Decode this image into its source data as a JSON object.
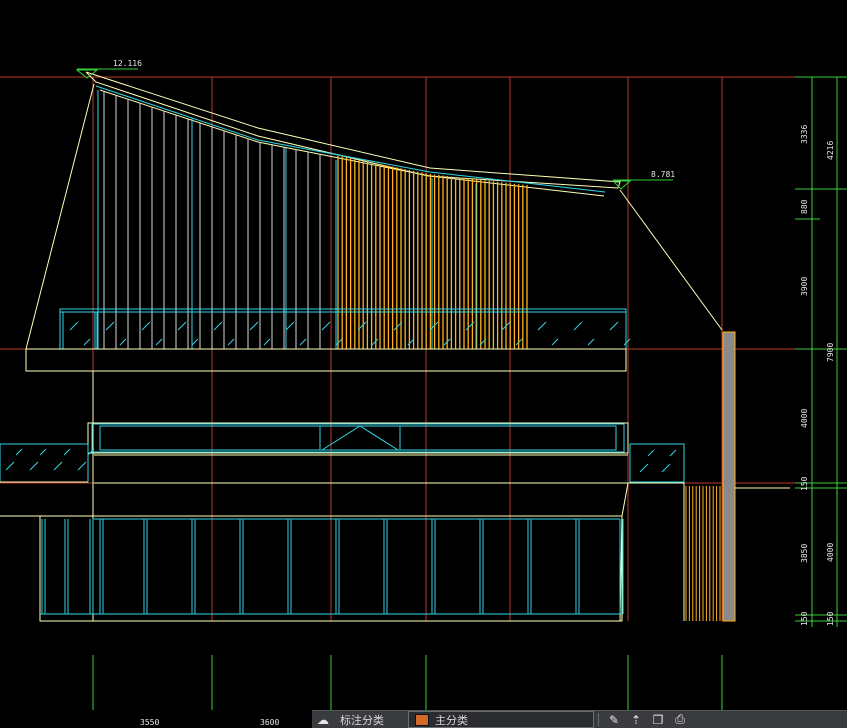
{
  "drawing": {
    "elevation_top": "12.116",
    "elevation_right": "8.781",
    "dims_right_inner": [
      "3336",
      "880",
      "3900",
      "4000",
      "150",
      "3850",
      "150"
    ],
    "dims_right_outer": [
      "4216",
      "7900",
      "4000",
      "150"
    ],
    "dims_bottom": [
      "3550",
      "3600"
    ],
    "colors": {
      "axis": "#b83a2c",
      "outline": "#ffffb4",
      "glass": "#2fd6e8",
      "highlight": "#ffb21c",
      "ground_lines": "#36d13a",
      "text": "#e8e8e8"
    }
  },
  "statusbar": {
    "item1_label": "标注分类",
    "layer_label": "主分类",
    "layer_color": "#d2692a",
    "icons": [
      "cloud-icon",
      "edit-icon",
      "arrow-up-icon",
      "copy-icon",
      "printer-icon"
    ]
  }
}
